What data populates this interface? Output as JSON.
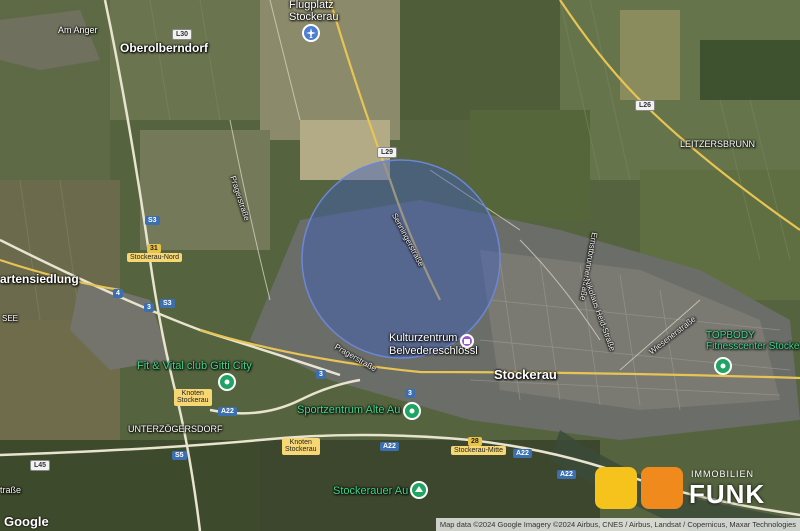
{
  "colors": {
    "radius_fill": "#3f5fbf",
    "radius_stroke": "#6c86d6",
    "brand_yellow": "#f6c21c",
    "brand_orange": "#f08a1c",
    "poi_green": "#1fa463",
    "airport_blue": "#4a7fd4",
    "culture_purple": "#9a57c8"
  },
  "map": {
    "places": {
      "airport_line1": "Flugplatz",
      "airport_line2": "Stockerau",
      "am_anger": "Am Anger",
      "oberolberndorf": "Oberolberndorf",
      "leitzersbrunn": "LEITZERSBRUNN",
      "gartensiedlung": "artensiedlung",
      "see": "SEE",
      "kulturzentrum_line1": "Kulturzentrum",
      "kulturzentrum_line2": "Belvedereschlössl",
      "fit_vital": "Fit & Vital club Gitti City",
      "topbody_line1": "TOPBODY",
      "topbody_line2": "Fitnesscenter Stocke",
      "stockerau": "Stockerau",
      "sportzentrum": "Sportzentrum Alte Au",
      "unterzoegersdorf": "UNTERZÖGERSDORF",
      "stockerauer_au": "Stockerauer Au"
    },
    "streets": {
      "pragerstrasse_n": "Pragerstraße",
      "pragerstrasse_s": "Pragerstraße",
      "senningerstrasse": "Senningerstraße",
      "ernstbrunner": "Ernstbrunnerstraße",
      "nikolaus_heid": "Nikolaus Heid-Straße",
      "wiesener": "Wiesenerstraße",
      "strasse_left": "traße"
    },
    "shields": {
      "l30": "L30",
      "l29": "L29",
      "l26": "L26",
      "l45": "L45",
      "s3_a": "S3",
      "s3_b": "S3",
      "s5": "S5",
      "n31": "31",
      "n4": "4",
      "n3a": "3",
      "n3b": "3",
      "n3c": "3",
      "a22_a": "A22",
      "a22_b": "A22",
      "a22_c": "A22",
      "a22_d": "A22",
      "n28": "28"
    },
    "junctions": {
      "stockerau_nord": "Stockerau-Nord",
      "knoten_line1": "Knoten",
      "knoten_line2": "Stockerau",
      "knoten2_line1": "Knoten",
      "knoten2_line2": "Stockerau",
      "stockerau_mitte": "Stockerau-Mitte"
    }
  },
  "branding": {
    "line1": "IMMOBILIEN",
    "line2": "FUNK"
  },
  "footer": {
    "google": "Google",
    "attribution": "Map data ©2024 Google Imagery ©2024 Airbus, CNES / Airbus, Landsat / Copernicus, Maxar Technologies"
  }
}
